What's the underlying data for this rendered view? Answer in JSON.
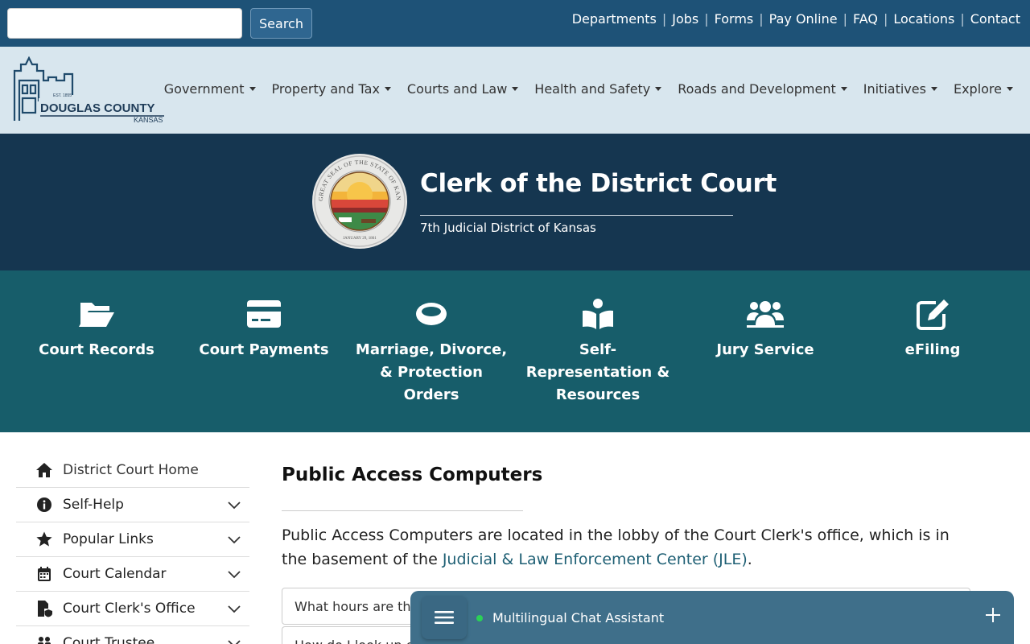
{
  "topbar": {
    "search_placeholder": "",
    "search_button": "Search",
    "links": [
      "Departments",
      "Jobs",
      "Forms",
      "Pay Online",
      "FAQ",
      "Locations",
      "Contact"
    ]
  },
  "logo": {
    "name": "DOUGLAS COUNTY",
    "state": "KANSAS",
    "est": "EST. 1855"
  },
  "nav": {
    "items": [
      "Government",
      "Property and Tax",
      "Courts and Law",
      "Health and Safety",
      "Roads and Development",
      "Initiatives",
      "Explore"
    ]
  },
  "banner": {
    "title": "Clerk of the District Court",
    "subtitle": "7th Judicial District of Kansas",
    "seal_text": "GREAT SEAL OF THE STATE OF KANSAS",
    "seal_date": "JANUARY 29, 1861"
  },
  "quick_links": [
    {
      "label": "Court Records",
      "icon": "folder-open-icon"
    },
    {
      "label": "Court Payments",
      "icon": "credit-card-icon"
    },
    {
      "label": "Marriage, Divorce, & Protection Orders",
      "icon": "ring-icon"
    },
    {
      "label": "Self-Representation & Resources",
      "icon": "book-reader-icon"
    },
    {
      "label": "Jury Service",
      "icon": "users-icon"
    },
    {
      "label": "eFiling",
      "icon": "edit-icon"
    }
  ],
  "sidebar": {
    "items": [
      {
        "label": "District Court Home",
        "icon": "home-icon"
      },
      {
        "label": "Self-Help",
        "icon": "info-icon"
      },
      {
        "label": "Popular Links",
        "icon": "star-icon"
      },
      {
        "label": "Court Calendar",
        "icon": "calendar-icon"
      },
      {
        "label": "Court Clerk's Office",
        "icon": "file-shield-icon"
      },
      {
        "label": "Court Trustee",
        "icon": "people-icon"
      }
    ]
  },
  "main": {
    "title": "Public Access Computers",
    "para_start": "Public Access Computers are located in the lobby of the Court Clerk's office, which is in the basement of the ",
    "para_link": "Judicial & Law Enforcement Center (JLE)",
    "para_end": ".",
    "accordion": [
      "What hours are the",
      "How do I look up ca"
    ]
  },
  "chat": {
    "title": "Multilingual Chat Assistant"
  },
  "colors": {
    "topbar": "#1e5277",
    "navbar": "#d8e6ee",
    "banner": "#153650",
    "quick": "#175d6a",
    "link": "#1e5f74",
    "chat": "#3f6f8a"
  }
}
